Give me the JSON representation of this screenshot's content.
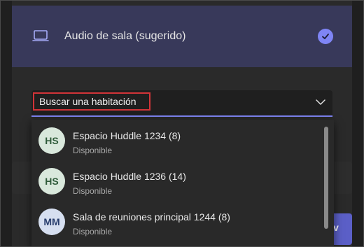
{
  "colors": {
    "accent": "#7f85f5",
    "header_bg": "#38395a",
    "highlight": "#d13438",
    "primary_button": "#5b5fc7"
  },
  "audio": {
    "title": "Audio de sala (sugerido)",
    "icon": "monitor-icon",
    "status_icon": "check-icon"
  },
  "search": {
    "value": "Buscar una habitación",
    "icon": "chevron-down-icon"
  },
  "rooms": [
    {
      "initials": "HS",
      "name": "Espacio Huddle 1234 (8)",
      "status": "Disponible",
      "color": "green"
    },
    {
      "initials": "HS",
      "name": "Espacio Huddle 1236 (14)",
      "status": "Disponible",
      "color": "green"
    },
    {
      "initials": "MM",
      "name": "Sala de reuniones principal 1244 (8)",
      "status": "Disponible",
      "color": "blue"
    }
  ],
  "background_button": {
    "label": "v"
  }
}
